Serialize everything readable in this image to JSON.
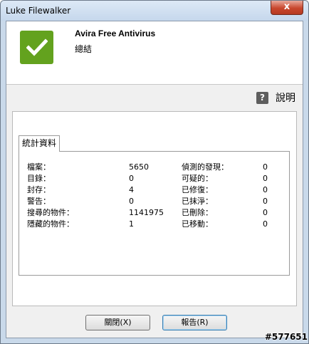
{
  "window": {
    "title": "Luke Filewalker",
    "close_label": "x"
  },
  "header": {
    "app_name": "Avira Free Antivirus",
    "subtitle": "總結",
    "icon": "checkmark-icon",
    "accent_color": "#63a21e"
  },
  "help": {
    "icon": "question-icon",
    "icon_glyph": "?",
    "label": "說明"
  },
  "stats": {
    "tab_label": "統計資料",
    "left": [
      {
        "label": "檔案：",
        "value": "5650"
      },
      {
        "label": "目錄：",
        "value": "0"
      },
      {
        "label": "封存：",
        "value": "4"
      },
      {
        "label": "警告：",
        "value": "0"
      },
      {
        "label": "搜尋的物件：",
        "value": "1141975"
      },
      {
        "label": "隱藏的物件：",
        "value": "1"
      }
    ],
    "right": [
      {
        "label": "偵測的發現：",
        "value": "0"
      },
      {
        "label": "可疑的：",
        "value": "0"
      },
      {
        "label": "已修復：",
        "value": "0"
      },
      {
        "label": "已抹淨：",
        "value": "0"
      },
      {
        "label": "已刪除：",
        "value": "0"
      },
      {
        "label": "已移動：",
        "value": "0"
      }
    ]
  },
  "buttons": {
    "close_label": "關閉(X)",
    "report_label": "報告(R)"
  },
  "watermark": "#577651"
}
